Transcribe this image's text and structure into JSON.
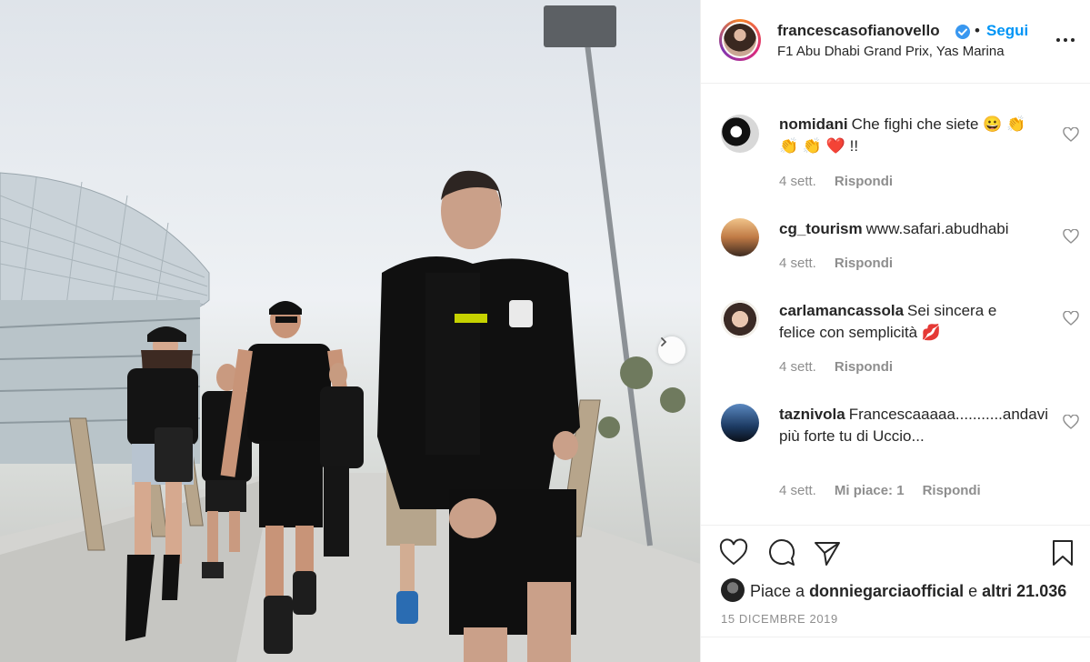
{
  "post": {
    "username": "francescasofianovello",
    "separator": "•",
    "follow_label": "Segui",
    "location": "F1 Abu Dhabi Grand Prix, Yas Marina"
  },
  "comments": [
    {
      "username": "nomidani",
      "text": "Che fighi che siete 😀 👏 👏 👏 ❤️ !!",
      "time": "4 sett.",
      "likes": "",
      "reply": "Rispondi"
    },
    {
      "username": "cg_tourism",
      "text": "www.safari.abudhabi",
      "time": "4 sett.",
      "likes": "",
      "reply": "Rispondi"
    },
    {
      "username": "carlamancassola",
      "text": "Sei sincera e felice con semplicità 💋",
      "time": "4 sett.",
      "likes": "",
      "reply": "Rispondi"
    },
    {
      "username": "taznivola",
      "text": "Francescaaaaa...........andavi più forte tu di Uccio...",
      "time": "4 sett.",
      "likes": "Mi piace: 1",
      "reply": "Rispondi"
    }
  ],
  "likes": {
    "prefix": "Piace a",
    "user": "donniegarciaofficial",
    "middle": "e",
    "others": "altri 21.036"
  },
  "date": "15 DICEMBRE 2019",
  "colors": {
    "accent": "#0095f6",
    "text": "#262626",
    "muted": "#8e8e8e",
    "divider": "#efefef"
  },
  "icons": [
    "verified-badge-icon",
    "more-options-icon",
    "heart-icon",
    "comment-icon",
    "share-icon",
    "bookmark-icon",
    "chevron-right-icon"
  ]
}
